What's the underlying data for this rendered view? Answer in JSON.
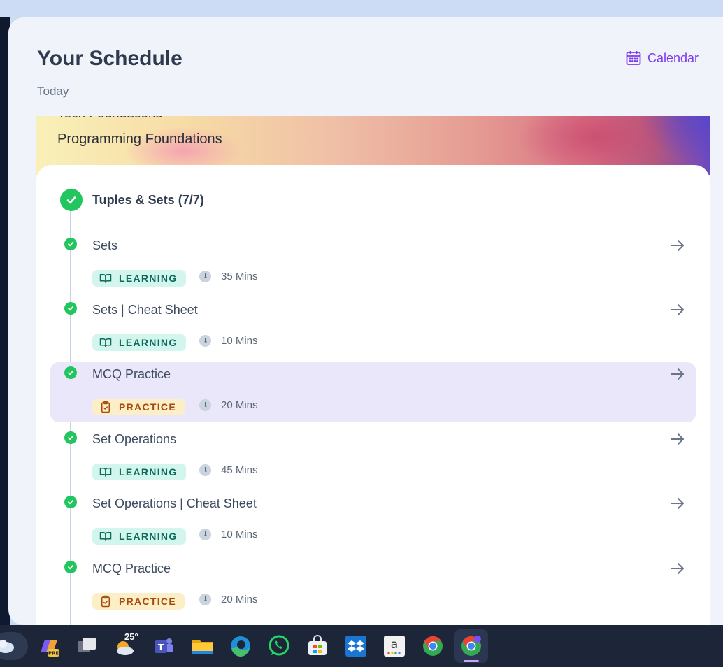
{
  "header": {
    "title": "Your Schedule",
    "subtitle": "Today",
    "calendar_label": "Calendar"
  },
  "banner": {
    "clipped_text": "Tech Foundations",
    "title": "Programming Foundations"
  },
  "module": {
    "title": "Tuples & Sets (7/7)"
  },
  "items": [
    {
      "title": "Sets",
      "tag": "LEARNING",
      "duration": "35 Mins"
    },
    {
      "title": "Sets | Cheat Sheet",
      "tag": "LEARNING",
      "duration": "10 Mins"
    },
    {
      "title": "MCQ Practice",
      "tag": "PRACTICE",
      "duration": "20 Mins"
    },
    {
      "title": "Set Operations",
      "tag": "LEARNING",
      "duration": "45 Mins"
    },
    {
      "title": "Set Operations | Cheat Sheet",
      "tag": "LEARNING",
      "duration": "10 Mins"
    },
    {
      "title": "MCQ Practice",
      "tag": "PRACTICE",
      "duration": "20 Mins"
    }
  ],
  "taskbar": {
    "weather_temp": "25°",
    "icons": [
      "weather-cloud-icon",
      "copilot-icon",
      "task-view-icon",
      "weather-icon",
      "teams-icon",
      "file-explorer-icon",
      "edge-icon",
      "whatsapp-icon",
      "microsoft-store-icon",
      "dropbox-icon",
      "amazon-icon",
      "chrome-icon",
      "chrome-profile-icon"
    ]
  },
  "colors": {
    "accent": "#7c3aed",
    "success": "#22c55e",
    "learning_bg": "#d2f5ee",
    "practice_bg": "#fcefc7",
    "highlight_bg": "#ebe7fb"
  }
}
